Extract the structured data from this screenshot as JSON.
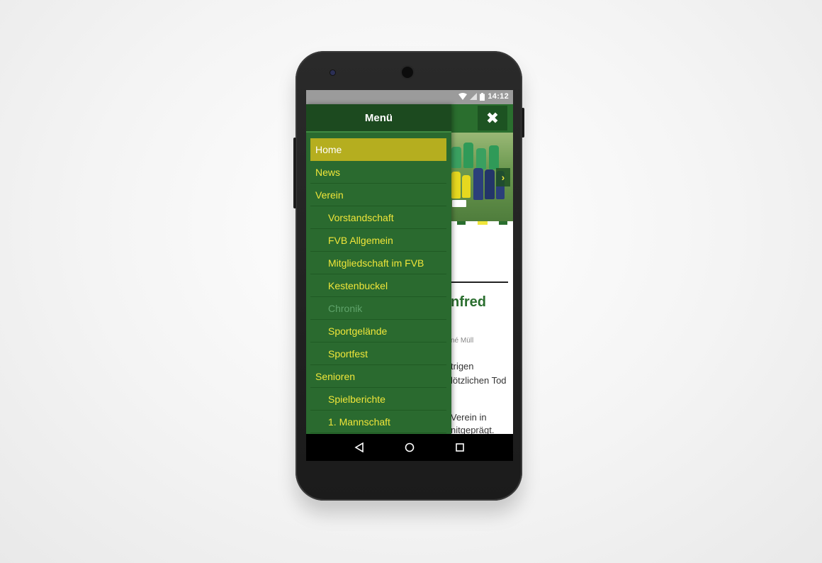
{
  "statusbar": {
    "time": "14:12"
  },
  "drawer": {
    "title": "Menü",
    "items": [
      {
        "label": "Home",
        "level": 0,
        "state": "active"
      },
      {
        "label": "News",
        "level": 0,
        "state": "normal"
      },
      {
        "label": "Verein",
        "level": 0,
        "state": "normal"
      },
      {
        "label": "Vorstandschaft",
        "level": 1,
        "state": "normal"
      },
      {
        "label": "FVB Allgemein",
        "level": 1,
        "state": "normal"
      },
      {
        "label": "Mitgliedschaft im FVB",
        "level": 1,
        "state": "normal"
      },
      {
        "label": "Kestenbuckel",
        "level": 1,
        "state": "normal"
      },
      {
        "label": "Chronik",
        "level": 1,
        "state": "muted"
      },
      {
        "label": "Sportgelände",
        "level": 1,
        "state": "normal"
      },
      {
        "label": "Sportfest",
        "level": 1,
        "state": "normal"
      },
      {
        "label": "Senioren",
        "level": 0,
        "state": "normal"
      },
      {
        "label": "Spielberichte",
        "level": 1,
        "state": "normal"
      },
      {
        "label": "1. Mannschaft",
        "level": 1,
        "state": "normal"
      }
    ]
  },
  "page": {
    "close_icon": "✖",
    "hero_next_icon": "›",
    "article_title_fragment": "nfred",
    "article_author_fragment": "né Müll",
    "article_lines": [
      "trigen",
      "lötzlichen Tod",
      "",
      "Verein in",
      "nitgeprägt."
    ]
  },
  "colors": {
    "brand_green": "#2a6e2e",
    "dark_green": "#1c4a1f",
    "accent_yellow": "#f0e63a",
    "active_item": "#b5ae1f"
  }
}
